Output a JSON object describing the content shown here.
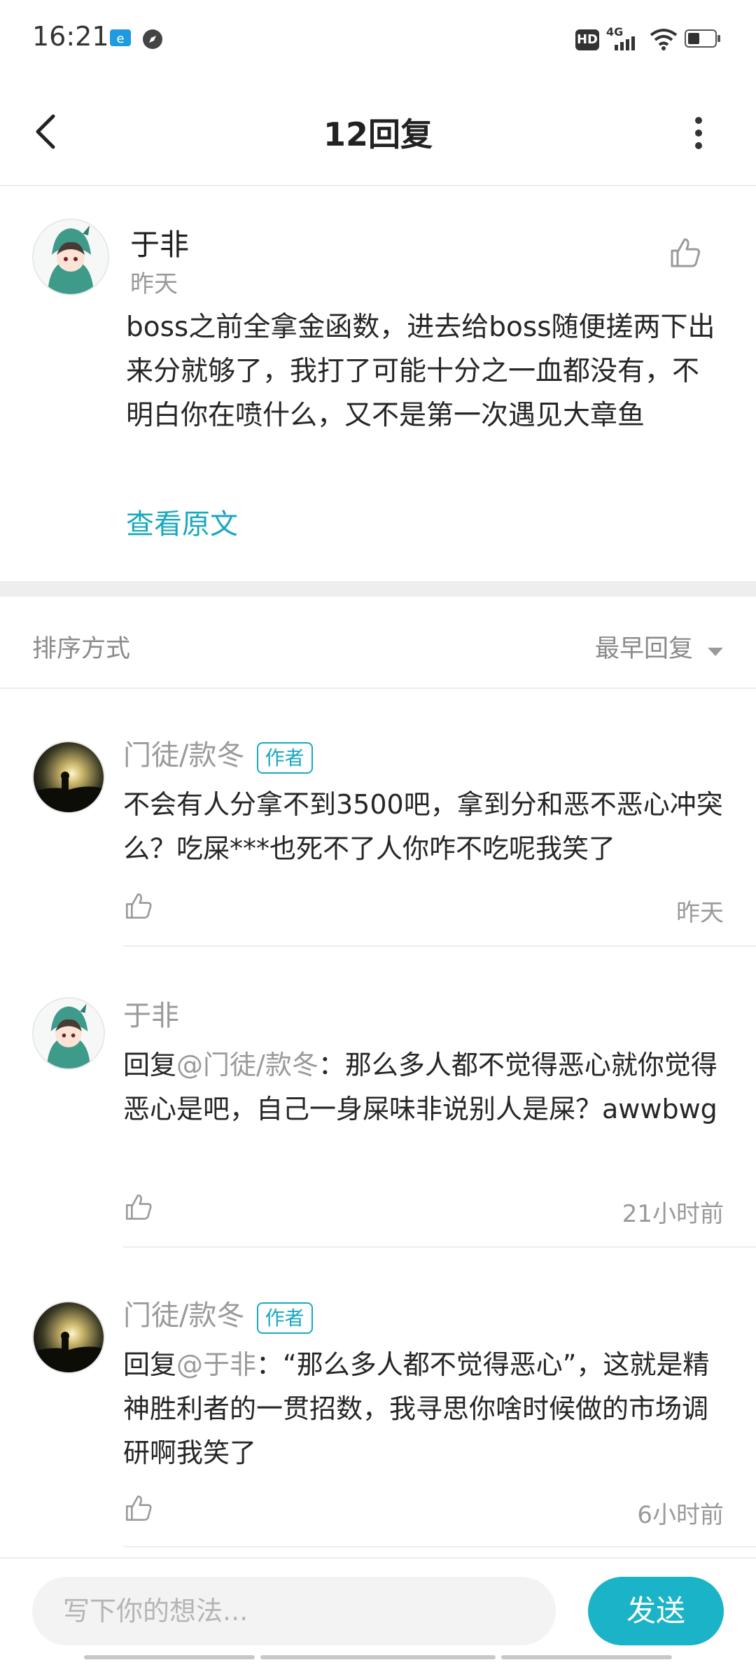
{
  "status_bar": {
    "time": "16:21",
    "icons": [
      "app-notification-icon",
      "compass-icon",
      "hd-icon",
      "signal-4g-icon",
      "wifi-icon",
      "battery-icon"
    ],
    "hd": "HD",
    "network": "4G"
  },
  "header": {
    "title": "12回复",
    "back_icon": "back-arrow-icon",
    "more_icon": "more-vertical-icon"
  },
  "main_comment": {
    "user": "于非",
    "time": "昨天",
    "content": "boss之前全拿金函数，进去给boss随便搓两下出来分就够了，我打了可能十分之一血都没有，不明白你在喷什么，又不是第一次遇见大章鱼",
    "view_original": "查看原文",
    "like_icon": "thumbs-up-icon"
  },
  "sort": {
    "label": "排序方式",
    "value": "最早回复"
  },
  "replies": [
    {
      "user": "门徒/款冬",
      "badge": "作者",
      "prefix": "",
      "mention": "",
      "text": "不会有人分拿不到3500吧，拿到分和恶不恶心冲突么？吃屎***也死不了人你咋不吃呢我笑了",
      "time": "昨天"
    },
    {
      "user": "于非",
      "badge": "",
      "prefix": "回复",
      "mention": "@门徒/款冬",
      "text": "：那么多人都不觉得恶心就你觉得恶心是吧，自己一身屎味非说别人是屎？awwbwg",
      "time": "21小时前"
    },
    {
      "user": "门徒/款冬",
      "badge": "作者",
      "prefix": "回复",
      "mention": "@于非",
      "text": "：“那么多人都不觉得恶心”，这就是精神胜利者的一贯招数，我寻思你啥时候做的市场调研啊我笑了",
      "time": "6小时前"
    }
  ],
  "composer": {
    "placeholder": "写下你的想法...",
    "send_label": "发送"
  },
  "colors": {
    "accent": "#18a9c0",
    "send_button": "#1ab3c7",
    "secondary_text": "#9a9a9a"
  }
}
